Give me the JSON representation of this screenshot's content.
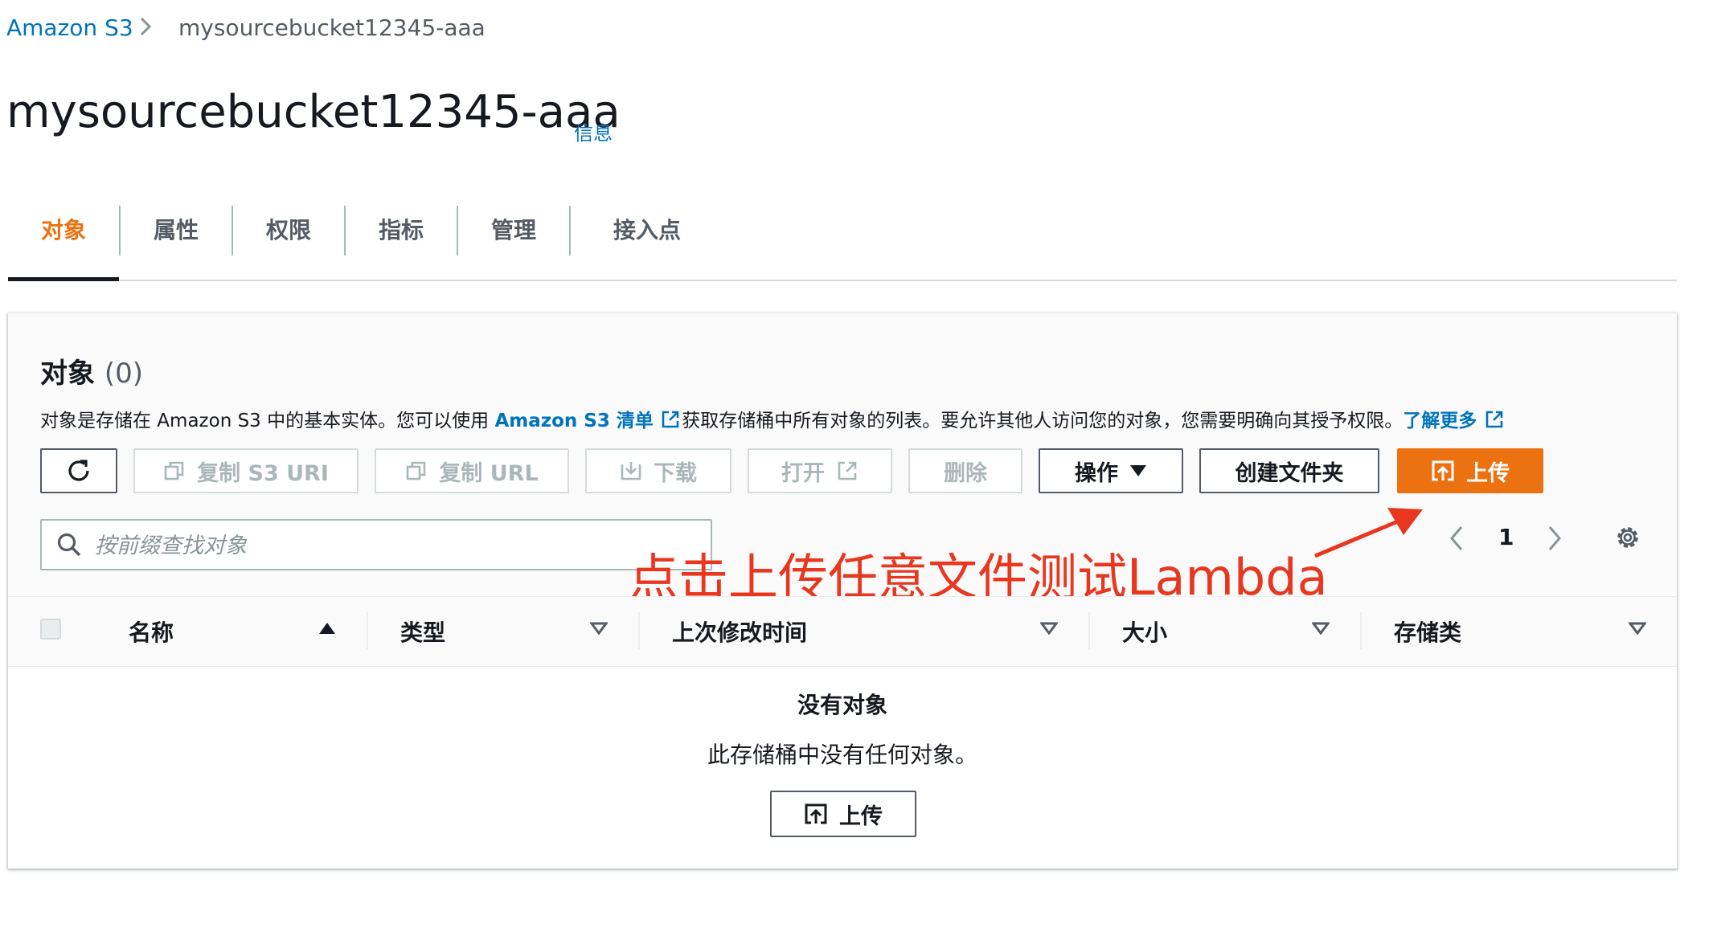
{
  "breadcrumb": {
    "root": "Amazon S3",
    "current": "mysourcebucket12345-aaa"
  },
  "page": {
    "title": "mysourcebucket12345-aaa",
    "info": "信息"
  },
  "tabs": [
    {
      "label": "对象",
      "active": true
    },
    {
      "label": "属性"
    },
    {
      "label": "权限"
    },
    {
      "label": "指标"
    },
    {
      "label": "管理"
    },
    {
      "label": "接入点"
    }
  ],
  "objects": {
    "title": "对象",
    "count": "(0)",
    "desc_1": "对象是存储在 Amazon S3 中的基本实体。您可以使用 ",
    "desc_link": "Amazon S3 清单",
    "desc_2": "获取存储桶中所有对象的列表。要允许其他人访问您的对象，您需要明确向其授予权限。",
    "learn_more": "了解更多"
  },
  "toolbar": {
    "copy_s3_uri": "复制 S3 URI",
    "copy_url": "复制 URL",
    "download": "下载",
    "open": "打开",
    "delete": "删除",
    "actions": "操作",
    "create_folder": "创建文件夹",
    "upload": "上传"
  },
  "search": {
    "placeholder": "按前缀查找对象"
  },
  "pagination": {
    "page": "1"
  },
  "annotation": "点击上传任意文件测试Lambda",
  "table": {
    "columns": [
      "名称",
      "类型",
      "上次修改时间",
      "大小",
      "存储类"
    ]
  },
  "empty": {
    "title": "没有对象",
    "text": "此存储桶中没有任何对象。",
    "button": "上传"
  },
  "colors": {
    "accent": "#ec7211",
    "link": "#0073bb",
    "annotation": "#e8361f"
  }
}
